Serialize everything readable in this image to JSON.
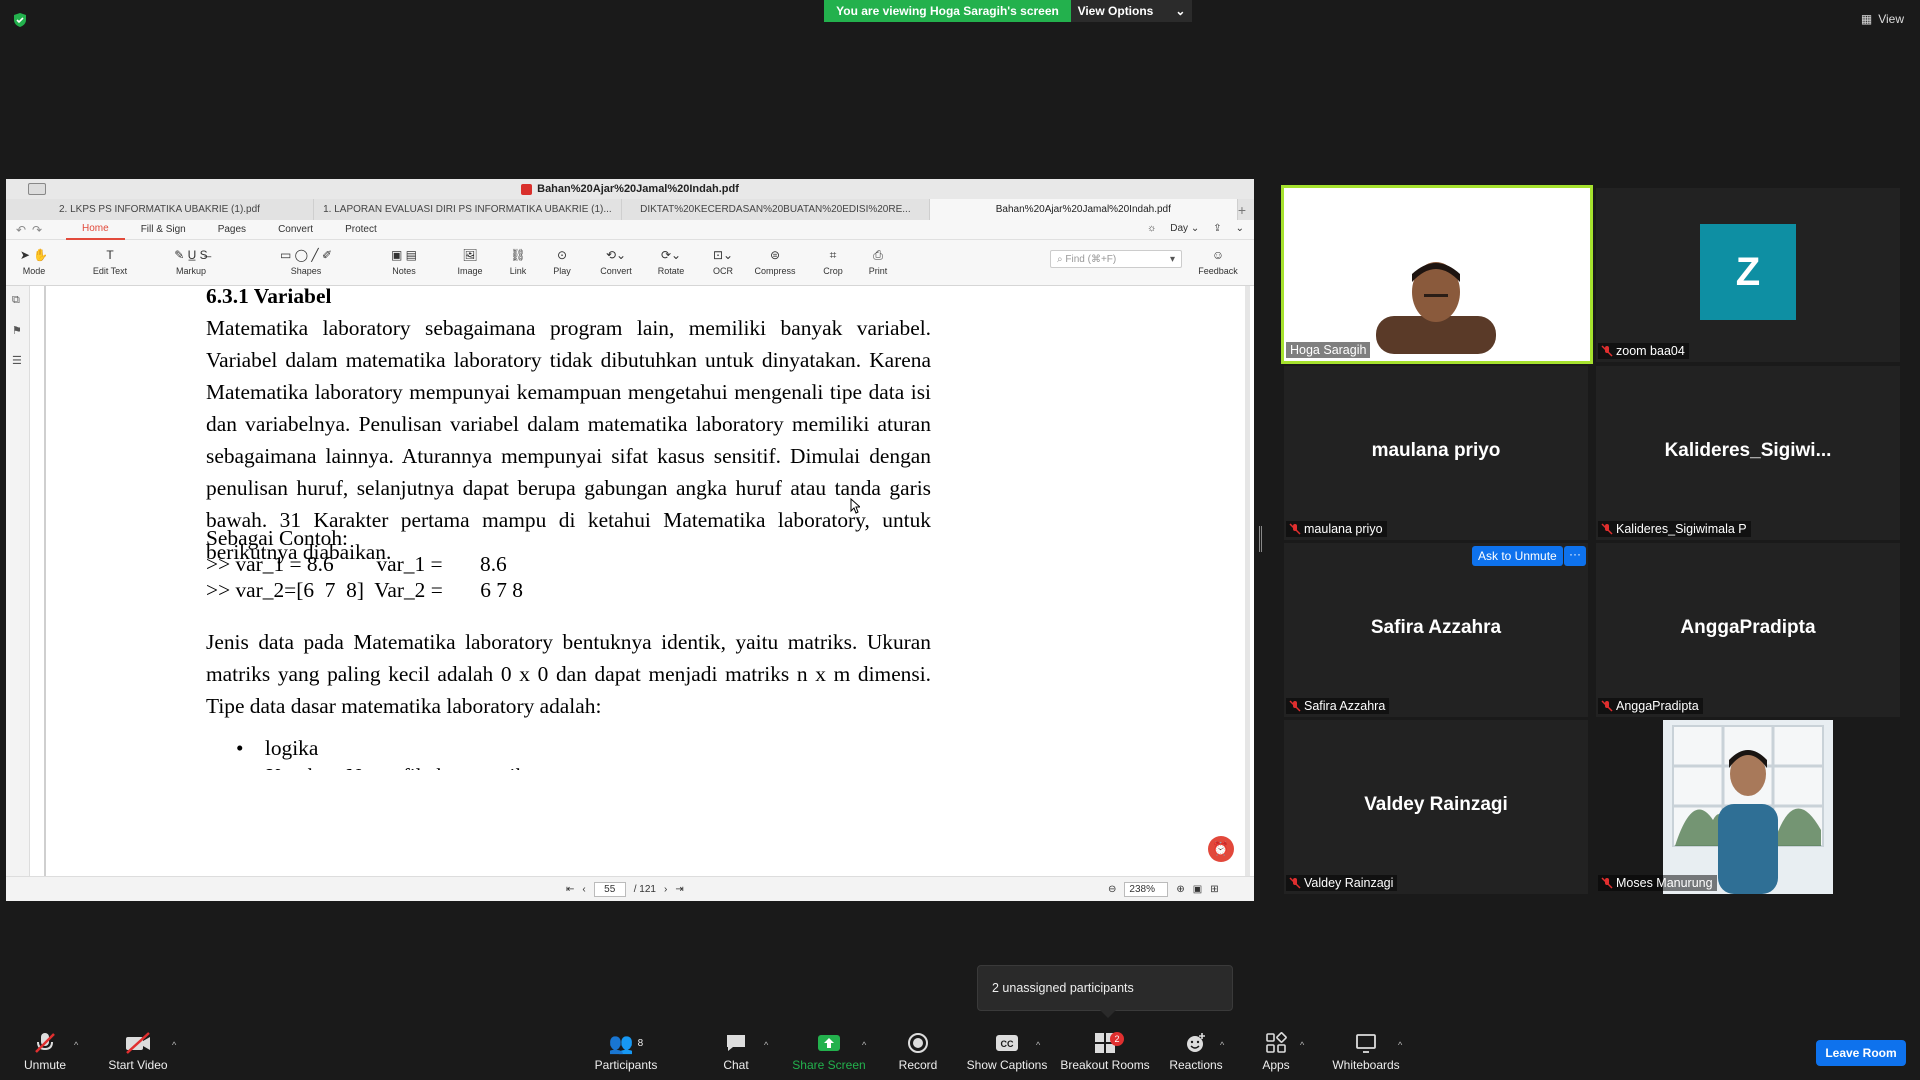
{
  "banner": {
    "viewing": "You are viewing Hoga Saragih's screen",
    "view_options": "View Options",
    "view": "View"
  },
  "pdf": {
    "title": "Bahan%20Ajar%20Jamal%20Indah.pdf",
    "tabs": [
      "2. LKPS PS INFORMATIKA UBAKRIE (1).pdf",
      "1. LAPORAN EVALUASI DIRI PS INFORMATIKA UBAKRIE (1)...",
      "DIKTAT%20KECERDASAN%20BUATAN%20EDISI%20RE...",
      "Bahan%20Ajar%20Jamal%20Indah.pdf"
    ],
    "menu": [
      "Home",
      "Fill & Sign",
      "Pages",
      "Convert",
      "Protect"
    ],
    "day": "Day",
    "tools": [
      "Mode",
      "Edit Text",
      "Markup",
      "Shapes",
      "Notes",
      "Image",
      "Link",
      "Play",
      "Convert",
      "Rotate",
      "OCR",
      "Compress",
      "Crop",
      "Print"
    ],
    "find_placeholder": "Find (⌘+F)",
    "feedback": "Feedback",
    "heading": "6.3.1 Variabel",
    "para1": "Matematika laboratory sebagaimana program lain, memiliki banyak variabel. Variabel dalam matematika laboratory tidak dibutuhkan untuk dinyatakan. Karena Matematika laboratory mempunyai kemampuan  mengetahui mengenali tipe data isi dan variabelnya. Penulisan variabel dalam matematika laboratory memiliki aturan sebagaimana lainnya. Aturannya mempunyai sifat kasus sensitif. Dimulai dengan penulisan huruf, selanjutnya dapat berupa gabungan angka huruf atau tanda garis bawah. 31 Karakter pertama mampu di ketahui Matematika laboratory, untuk berikutnya diabaikan.",
    "contoh": "Sebagai Contoh:",
    "code1": ">> var_1 = 8.6        var_1 =       8.6",
    "code2": ">> var_2=[6  7  8]  Var_2 =       6 7 8",
    "para2": "Jenis data pada Matematika laboratory bentuknya identik, yaitu matriks. Ukuran matriks yang paling kecil adalah 0 x 0 dan dapat menjadi matriks n x m dimensi. Tipe data dasar matematika laboratory adalah:",
    "bullet1": "logika",
    "bullet2_partial": "Karakter Nama file harus unik",
    "page_current": "55",
    "page_total": "/ 121",
    "zoom": "238%"
  },
  "participants": {
    "hoga": "Hoga Saragih",
    "zoom_baa": "zoom baa04",
    "z_initial": "Z",
    "maulana_big": "maulana priyo",
    "maulana": "maulana priyo",
    "kalideres_big": "Kalideres_Sigiwi...",
    "kalideres": "Kalideres_Sigiwimala P",
    "safira_big": "Safira Azzahra",
    "safira": "Safira Azzahra",
    "angga_big": "AnggaPradipta",
    "angga": "AnggaPradipta",
    "valdey_big": "Valdey Rainzagi",
    "valdey": "Valdey Rainzagi",
    "moses": "Moses Manurung",
    "ask_unmute": "Ask to Unmute",
    "more": "···"
  },
  "tooltip": "2 unassigned participants",
  "toolbar": {
    "unmute": "Unmute",
    "start_video": "Start Video",
    "participants": "Participants",
    "participants_count": "8",
    "chat": "Chat",
    "share_screen": "Share Screen",
    "record": "Record",
    "show_captions": "Show Captions",
    "breakout_rooms": "Breakout Rooms",
    "breakout_badge": "2",
    "reactions": "Reactions",
    "apps": "Apps",
    "whiteboards": "Whiteboards",
    "leave_room": "Leave Room"
  },
  "colors": {
    "share_green": "#23b14d",
    "zoom_blue": "#0e72ed",
    "active_speaker": "#a6e22e",
    "mute_red": "#e02f2f",
    "avatar_teal": "#0e8fa3"
  }
}
